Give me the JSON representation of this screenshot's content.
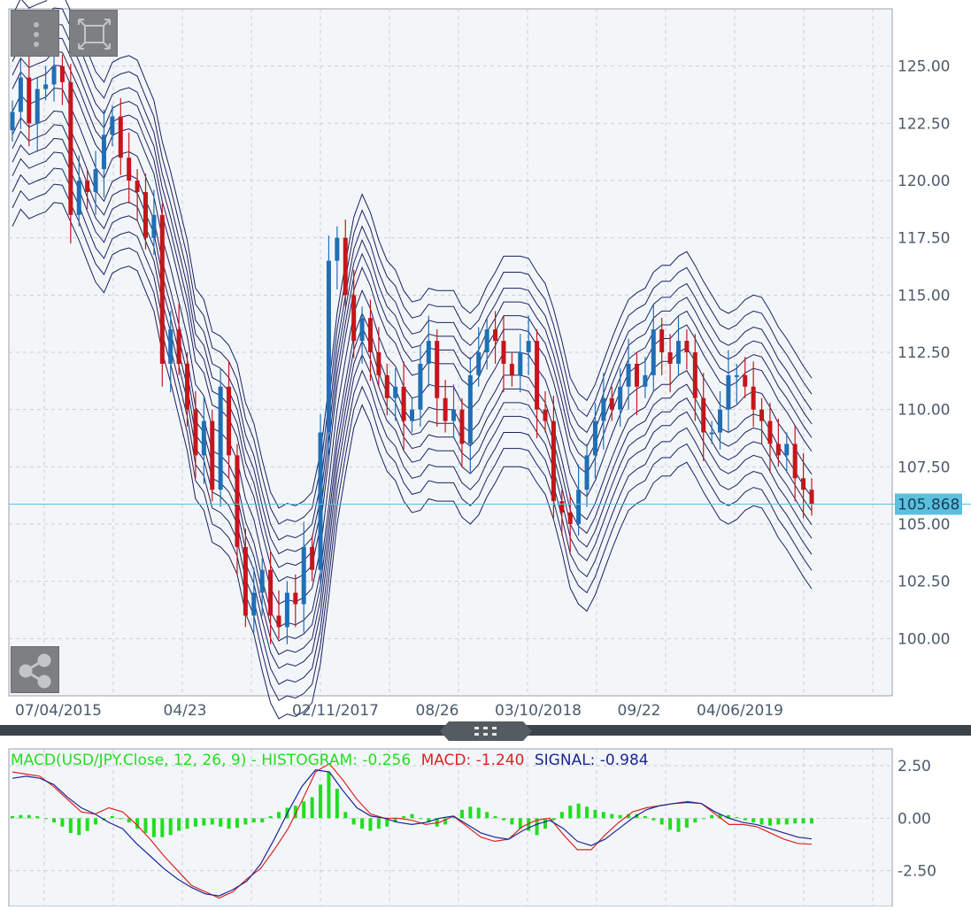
{
  "toolbar": {
    "menu_icon": "vertical-dots-icon",
    "fullscreen_icon": "expand-icon",
    "share_icon": "share-icon"
  },
  "main_chart": {
    "y_ticks": [
      "125.00",
      "122.50",
      "120.00",
      "117.50",
      "115.00",
      "112.50",
      "110.00",
      "107.50",
      "105.00",
      "102.50",
      "100.00"
    ],
    "x_ticks": [
      "07/04/2015",
      "04/23",
      "02/11/2017",
      "08/26",
      "03/10/2018",
      "09/22",
      "04/06/2019"
    ],
    "last_price_label": "105.868"
  },
  "macd_panel": {
    "legend_name": "MACD(USD/JPY.Close, 12, 26, 9) - HISTOGRAM: -0.256",
    "legend_macd": "MACD: -1.240",
    "legend_signal": "SIGNAL: -0.984",
    "y_ticks": [
      "2.50",
      "0.00",
      "-2.50"
    ]
  },
  "colors": {
    "background": "#f3f6f9",
    "grid": "#c9ced6",
    "candle_up": "#1f6fb5",
    "candle_down": "#c4161c",
    "band_line": "#1c2060",
    "price_line": "#5bc0de",
    "histogram": "#22dd22",
    "macd_line": "#dd2222",
    "signal_line": "#1c2599",
    "divider": "#3c4348"
  },
  "chart_data": {
    "type": "candlestick",
    "series_name": "USD/JPY",
    "ylim": [
      97.5,
      127.5
    ],
    "last_price": 105.868,
    "closes": [
      123.0,
      124.5,
      122.5,
      124.0,
      124.2,
      125.0,
      124.3,
      118.5,
      120.0,
      119.5,
      120.5,
      122.0,
      122.8,
      121.0,
      120.0,
      119.5,
      117.5,
      118.5,
      112.0,
      113.5,
      112.0,
      110.0,
      108.0,
      109.5,
      106.5,
      111.0,
      108.0,
      104.0,
      101.0,
      102.0,
      103.0,
      101.0,
      100.5,
      102.0,
      101.5,
      104.0,
      103.0,
      109.0,
      116.5,
      117.5,
      115.0,
      113.0,
      114.0,
      112.5,
      111.5,
      110.5,
      111.0,
      109.5,
      110.0,
      112.0,
      113.0,
      110.5,
      109.5,
      110.0,
      108.5,
      111.5,
      112.5,
      113.5,
      113.0,
      112.0,
      111.5,
      112.5,
      113.0,
      110.0,
      109.5,
      106.0,
      105.5,
      105.0,
      106.5,
      108.0,
      109.5,
      110.5,
      110.0,
      111.0,
      112.0,
      111.0,
      111.5,
      113.5,
      112.5,
      112.0,
      113.0,
      112.5,
      110.5,
      109.0,
      109.0,
      110.0,
      111.5,
      111.5,
      111.0,
      110.0,
      109.5,
      108.5,
      108.0,
      108.5,
      107.0,
      106.5,
      105.868
    ],
    "macd": {
      "ylim": [
        -4.2,
        3.3
      ],
      "histogram": [
        0.1,
        0.15,
        0.15,
        0.1,
        0.0,
        -0.2,
        -0.4,
        -0.7,
        -0.8,
        -0.6,
        -0.3,
        -0.1,
        0.1,
        0.0,
        -0.2,
        -0.5,
        -0.7,
        -0.9,
        -0.9,
        -0.8,
        -0.6,
        -0.5,
        -0.4,
        -0.35,
        -0.3,
        -0.4,
        -0.5,
        -0.45,
        -0.3,
        -0.2,
        -0.2,
        0.1,
        0.3,
        0.5,
        0.6,
        0.8,
        1.0,
        1.6,
        2.2,
        1.4,
        0.3,
        -0.3,
        -0.5,
        -0.6,
        -0.5,
        -0.4,
        -0.2,
        0.1,
        0.2,
        0.0,
        -0.2,
        -0.4,
        -0.3,
        0.1,
        0.4,
        0.55,
        0.5,
        0.3,
        0.1,
        -0.1,
        -0.3,
        -0.5,
        -0.6,
        -0.8,
        -0.5,
        -0.1,
        0.3,
        0.6,
        0.7,
        0.55,
        0.4,
        0.3,
        0.2,
        0.15,
        0.2,
        0.2,
        0.1,
        -0.1,
        -0.3,
        -0.55,
        -0.65,
        -0.45,
        -0.2,
        0.0,
        0.15,
        0.2,
        0.15,
        0.05,
        -0.1,
        -0.2,
        -0.3,
        -0.35,
        -0.3,
        -0.3,
        -0.25,
        -0.25,
        -0.256
      ],
      "macd_line": [
        2.2,
        2.1,
        2.0,
        1.5,
        0.9,
        0.3,
        0.2,
        0.5,
        0.3,
        -0.3,
        -1.0,
        -1.8,
        -2.5,
        -3.2,
        -3.5,
        -3.8,
        -3.5,
        -2.9,
        -2.4,
        -1.5,
        -0.5,
        0.8,
        2.2,
        2.6,
        1.8,
        0.9,
        0.2,
        0.0,
        0.0,
        -0.1,
        -0.3,
        -0.2,
        0.1,
        -0.4,
        -0.9,
        -1.1,
        -1.0,
        -0.4,
        -0.1,
        0.0,
        -0.8,
        -1.5,
        -1.5,
        -0.8,
        -0.2,
        0.3,
        0.5,
        0.6,
        0.7,
        0.8,
        0.7,
        0.2,
        -0.3,
        -0.3,
        -0.4,
        -0.7,
        -1.0,
        -1.2,
        -1.24
      ],
      "signal_line": [
        1.9,
        2.0,
        1.9,
        1.6,
        1.0,
        0.5,
        0.2,
        -0.2,
        -0.5,
        -1.2,
        -1.8,
        -2.4,
        -2.9,
        -3.3,
        -3.6,
        -3.7,
        -3.4,
        -3.0,
        -2.2,
        -1.0,
        0.3,
        1.5,
        2.3,
        2.2,
        1.3,
        0.5,
        0.1,
        0.0,
        -0.2,
        -0.3,
        -0.2,
        0.0,
        0.1,
        -0.3,
        -0.7,
        -0.9,
        -1.0,
        -0.6,
        -0.3,
        -0.1,
        -0.5,
        -1.1,
        -1.3,
        -1.0,
        -0.5,
        0.0,
        0.4,
        0.6,
        0.7,
        0.75,
        0.7,
        0.3,
        0.0,
        -0.2,
        -0.3,
        -0.5,
        -0.7,
        -0.9,
        -0.984
      ]
    }
  }
}
